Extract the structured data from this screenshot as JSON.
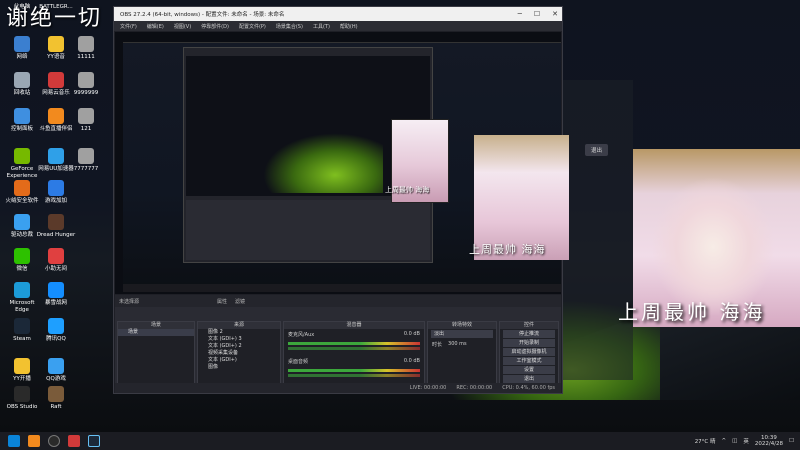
{
  "overlay": {
    "title": "谢绝一切"
  },
  "desktop_icons": [
    {
      "label": "此电脑",
      "icon": "computer-icon",
      "color": "#4a90d9"
    },
    {
      "label": "BATTLEGR...",
      "icon": "game-icon",
      "color": "#d9a040"
    },
    {
      "label": "网络",
      "icon": "network-icon",
      "color": "#3b7fd0"
    },
    {
      "label": "YY语音",
      "icon": "yy-icon",
      "color": "#f2c230"
    },
    {
      "label": "11111",
      "icon": "folder-icon",
      "color": "#a0a0a0"
    },
    {
      "label": "回收站",
      "icon": "recycle-bin-icon",
      "color": "#9aa7b4"
    },
    {
      "label": "网易云音乐",
      "icon": "music-icon",
      "color": "#d23a3a"
    },
    {
      "label": "9999999",
      "icon": "folder-icon",
      "color": "#a0a0a0"
    },
    {
      "label": "控制面板",
      "icon": "control-panel-icon",
      "color": "#3f8fe0"
    },
    {
      "label": "斗鱼直播伴侣",
      "icon": "douyu-icon",
      "color": "#f28a1e"
    },
    {
      "label": "121",
      "icon": "folder-icon",
      "color": "#a0a0a0"
    },
    {
      "label": "GeForce Experience",
      "icon": "geforce-icon",
      "color": "#76b900"
    },
    {
      "label": "网易UU加速器",
      "icon": "uu-icon",
      "color": "#2fa0e8"
    },
    {
      "label": "7777777",
      "icon": "folder-icon",
      "color": "#a0a0a0"
    },
    {
      "label": "火绒安全软件",
      "icon": "huorong-icon",
      "color": "#e36b1a"
    },
    {
      "label": "游戏加加",
      "icon": "game-plus-icon",
      "color": "#2c7be5"
    },
    {
      "label": "驱动总裁",
      "icon": "driver-icon",
      "color": "#3aa0f0"
    },
    {
      "label": "Dread Hunger",
      "icon": "dread-hunger-icon",
      "color": "#5b3a2a"
    },
    {
      "label": "微信",
      "icon": "wechat-icon",
      "color": "#2dc100"
    },
    {
      "label": "小助无间",
      "icon": "assistant-icon",
      "color": "#e04040"
    },
    {
      "label": "Microsoft Edge",
      "icon": "edge-icon",
      "color": "#1c9bd8"
    },
    {
      "label": "暴雪战网",
      "icon": "battlenet-icon",
      "color": "#148eff"
    },
    {
      "label": "Steam",
      "icon": "steam-icon",
      "color": "#1b2838"
    },
    {
      "label": "腾讯QQ",
      "icon": "qq-icon",
      "color": "#1e9fff"
    },
    {
      "label": "YY开播",
      "icon": "yy-live-icon",
      "color": "#f2c230"
    },
    {
      "label": "QQ游戏",
      "icon": "qq-game-icon",
      "color": "#3aa0f0"
    },
    {
      "label": "OBS Studio",
      "icon": "obs-icon",
      "color": "#2a2a2a"
    },
    {
      "label": "Raft",
      "icon": "raft-icon",
      "color": "#7a5b3a"
    }
  ],
  "obs": {
    "title": "OBS 27.2.4 (64-bit, windows) - 配置文件: 未命名 - 场景: 未命名",
    "menu": [
      "文件(F)",
      "编辑(E)",
      "视图(V)",
      "停靠部件(D)",
      "配置文件(P)",
      "场景集合(S)",
      "工具(T)",
      "帮助(H)"
    ],
    "dock_header": [
      "未选择源",
      "属性",
      "滤镜"
    ],
    "panels": {
      "scenes": {
        "title": "场景",
        "items": [
          "场景"
        ]
      },
      "sources": {
        "title": "来源",
        "items": [
          "图像 2",
          "文本 (GDI+) 3",
          "文本 (GDI+) 2",
          "视频采集设备",
          "文本 (GDI+)",
          "图像"
        ]
      },
      "mixer": {
        "title": "混音器",
        "channels": [
          {
            "name": "麦克风/Aux",
            "db": "0.0 dB"
          },
          {
            "name": "桌面音频",
            "db": "0.0 dB"
          }
        ]
      },
      "transitions": {
        "title": "转场特效",
        "type": "淡出",
        "duration_label": "时长",
        "duration": "300 ms"
      },
      "controls": {
        "title": "控件",
        "buttons": [
          "停止推流",
          "开始录制",
          "启动虚拟摄像机",
          "工作室模式",
          "设置",
          "退出"
        ]
      }
    },
    "status": [
      "LIVE: 00:00:00",
      "REC: 00:00:00",
      "CPU: 0.4%, 60.00 fps"
    ]
  },
  "overlay_captions": {
    "big": "上周最帅 海海",
    "med": "上周最帅 海海",
    "small": "上周最帅 海海"
  },
  "side_panel": {
    "exit_label": "退出"
  },
  "taskbar": {
    "weather": "27°C 晴",
    "time": "10:39",
    "date": "2022/4/28",
    "lang": "英"
  }
}
